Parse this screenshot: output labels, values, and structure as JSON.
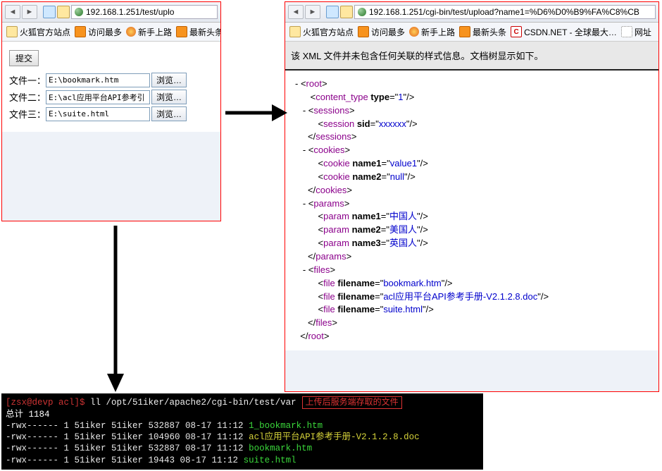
{
  "panel1": {
    "url": "192.168.1.251/test/uplo",
    "bookmarks": [
      "火狐官方站点",
      "访问最多",
      "新手上路",
      "最新头条"
    ],
    "submit": "提交",
    "rows": [
      {
        "label": "文件一：",
        "value": "E:\\bookmark.htm",
        "browse": "浏览…"
      },
      {
        "label": "文件二：",
        "value": "E:\\acl应用平台API参考引",
        "browse": "浏览…"
      },
      {
        "label": "文件三：",
        "value": "E:\\suite.html",
        "browse": "浏览…"
      }
    ]
  },
  "panel2": {
    "url": "192.168.1.251/cgi-bin/test/upload?name1=%D6%D0%B9%FA%C8%CB",
    "bookmarks": [
      "火狐官方站点",
      "访问最多",
      "新手上路",
      "最新头条",
      "CSDN.NET - 全球最大…",
      "网址"
    ],
    "notice": "该 XML 文件并未包含任何关联的样式信息。文档树显示如下。",
    "xml": {
      "root": "root",
      "content_type": {
        "tag": "content_type",
        "attr": "type",
        "val": "1"
      },
      "sessions": {
        "tag": "sessions",
        "child": {
          "tag": "session",
          "attr": "sid",
          "val": "xxxxxx"
        }
      },
      "cookies": {
        "tag": "cookies",
        "children": [
          {
            "tag": "cookie",
            "attr": "name1",
            "val": "value1"
          },
          {
            "tag": "cookie",
            "attr": "name2",
            "val": "null"
          }
        ]
      },
      "params": {
        "tag": "params",
        "children": [
          {
            "tag": "param",
            "attr": "name1",
            "val": "中国人"
          },
          {
            "tag": "param",
            "attr": "name2",
            "val": "美国人"
          },
          {
            "tag": "param",
            "attr": "name3",
            "val": "英国人"
          }
        ]
      },
      "files": {
        "tag": "files",
        "children": [
          {
            "tag": "file",
            "attr": "filename",
            "val": "bookmark.htm"
          },
          {
            "tag": "file",
            "attr": "filename",
            "val": "acl应用平台API参考手册-V2.1.2.8.doc"
          },
          {
            "tag": "file",
            "attr": "filename",
            "val": "suite.html"
          }
        ]
      }
    }
  },
  "terminal": {
    "box": "上传后服务端存取的文件",
    "prompt_user": "[zsx@devp acl]$ ",
    "prompt_cmd": "ll /opt/51iker/apache2/cgi-bin/test/var",
    "total": "总计 1184",
    "rows": [
      {
        "perm": "-rwx------ 1 51iker 51iker 532887 08-17 11:12 ",
        "name": "1_bookmark.htm",
        "cls": "fn"
      },
      {
        "perm": "-rwx------ 1 51iker 51iker 104960 08-17 11:12 ",
        "name": "acl应用平台API参考手册-V2.1.2.8.doc",
        "cls": "fn2"
      },
      {
        "perm": "-rwx------ 1 51iker 51iker 532887 08-17 11:12 ",
        "name": "bookmark.htm",
        "cls": "fn"
      },
      {
        "perm": "-rwx------ 1 51iker 51iker  19443 08-17 11:12 ",
        "name": "suite.html",
        "cls": "fn"
      }
    ]
  }
}
